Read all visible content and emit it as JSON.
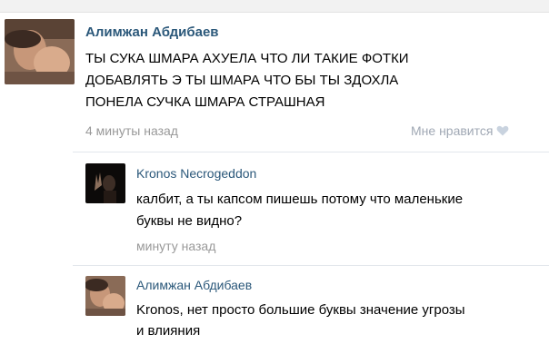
{
  "comments": [
    {
      "author": "Алимжан Абдибаев",
      "lines": [
        "ТЫ СУКА ШМАРА АХУЕЛА ЧТО ЛИ ТАКИЕ ФОТКИ",
        "ДОБАВЛЯТЬ Э ТЫ ШМАРА ЧТО БЫ ТЫ ЗДОХЛА",
        "ПОНЕЛА СУЧКА ШМАРА СТРАШНАЯ"
      ],
      "time": "4 минуты назад",
      "like_label": "Мне нравится",
      "like_icon": "heart-icon"
    }
  ],
  "replies": [
    {
      "author": "Kronos Necrogeddon",
      "lines": [
        "калбит, а ты капсом пишешь потому что маленькие",
        "буквы не видно?"
      ],
      "time": "минуту назад"
    },
    {
      "author": "Алимжан Абдибаев",
      "lines": [
        "Kronos, нет просто большие буквы значение угрозы",
        "и влияния"
      ]
    }
  ],
  "colors": {
    "author": "#2b587a",
    "meta": "#999999",
    "like": "#a0a8b4",
    "divider": "#e3e7ec"
  }
}
